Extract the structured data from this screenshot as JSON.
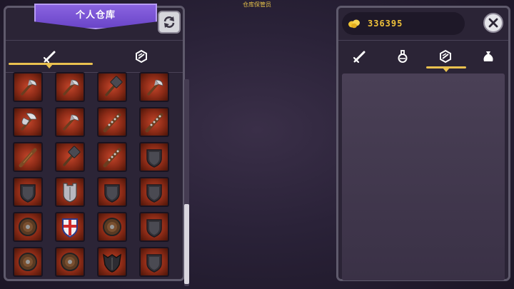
{
  "npc_title": "仓库保管员",
  "left_panel": {
    "title": "个人仓库",
    "refresh_icon": "refresh-icon",
    "tabs": [
      {
        "icon": "sword-icon",
        "active": true
      },
      {
        "icon": "armor-icon",
        "active": false
      }
    ],
    "scroll_fraction": 0.6
  },
  "right_panel": {
    "gold_icon": "gold-coins-icon",
    "gold_amount": "336395",
    "close_icon": "close-icon",
    "tabs": [
      {
        "icon": "sword-icon",
        "active": false
      },
      {
        "icon": "potion-icon",
        "active": false
      },
      {
        "icon": "armor-icon",
        "active": true
      },
      {
        "icon": "bag-icon",
        "active": false
      }
    ]
  },
  "items": [
    [
      "axe-icon",
      "axe-icon",
      "hammer-icon",
      "axe-icon"
    ],
    [
      "double-axe-icon",
      "axe-icon",
      "spiked-club-icon",
      "spiked-club-icon"
    ],
    [
      "club-icon",
      "hammer-icon",
      "spiked-club-icon",
      "shield-icon"
    ],
    [
      "shield-icon",
      "tower-shield-icon",
      "shield-icon",
      "shield-icon"
    ],
    [
      "round-shield-icon",
      "cross-shield-icon",
      "round-shield-icon",
      "shield-icon"
    ],
    [
      "round-shield-icon",
      "round-shield-icon",
      "winged-shield-icon",
      "shield-icon"
    ]
  ],
  "colors": {
    "accent": "#e9c14f",
    "banner": "#7a55d6",
    "slot": "#a83820",
    "gold_text": "#f0c23a"
  }
}
